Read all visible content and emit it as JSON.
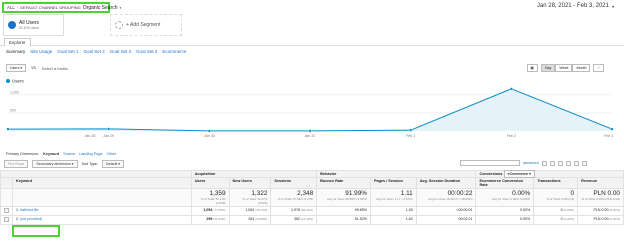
{
  "breadcrumb": {
    "root": "ALL",
    "dimension": "DEFAULT CHANNEL GROUPING",
    "current": "Organic Search"
  },
  "date_range": "Jan 28, 2021 - Feb 3, 2021",
  "segments": {
    "all_users_title": "All Users",
    "all_users_sub": "52.11% Users",
    "add_segment": "+ Add Segment"
  },
  "tabs": {
    "explorer": "Explorer"
  },
  "subtabs": [
    "Summary",
    "Site Usage",
    "Goal Set 1",
    "Goal Set 2",
    "Goal Set 3",
    "Goal Set 4",
    "Ecommerce"
  ],
  "chart_controls": {
    "metric": "Users",
    "vs": "VS.",
    "select_metric": "Select a metric",
    "periods": [
      "Day",
      "Week",
      "Month"
    ]
  },
  "chart_data": {
    "type": "area",
    "series": [
      {
        "name": "Users",
        "values": [
          53,
          59,
          2,
          3,
          23,
          1166,
          53
        ]
      }
    ],
    "categories": [
      "Jan 28",
      "Jan 29",
      "Jan 30",
      "Jan 31",
      "Feb 1",
      "Feb 2",
      "Feb 3"
    ],
    "yticks": [
      "1,000",
      "500"
    ],
    "ylim": [
      0,
      1300
    ],
    "color": "#058dc7"
  },
  "primary_dimension": {
    "label": "Primary Dimension:",
    "options": [
      "Keyword",
      "Source",
      "Landing Page",
      "Other"
    ]
  },
  "table_controls": {
    "plot_rows": "Plot Rows",
    "secondary_dimension": "Secondary dimension",
    "sort_type_label": "Sort Type:",
    "sort_type": "Default",
    "advanced": "advanced"
  },
  "table": {
    "group_headers": {
      "acquisition": "Acquisition",
      "behavior": "Behavior",
      "conversions": "Conversions",
      "ecommerce": "eCommerce"
    },
    "columns": [
      "Keyword",
      "Users",
      "New Users",
      "Sessions",
      "Bounce Rate",
      "Pages / Session",
      "Avg. Session Duration",
      "Ecommerce Conversion Rate",
      "Transactions",
      "Revenue"
    ],
    "totals": {
      "users": "1,359",
      "users_sub": "% of Total: 52.11% (2,608)",
      "new_users": "1,322",
      "new_users_sub": "% of Total: 52.27% (2,529)",
      "sessions": "2,348",
      "sessions_sub": "% of Total: 67.54% (3,476)",
      "bounce": "91.99%",
      "bounce_sub": "Avg for View: 88.85% (3.53%)",
      "pages": "1.11",
      "pages_sub": "Avg for View: 1.17 (-4.97%)",
      "duration": "00:00:22",
      "duration_sub": "Avg for View: 00:00:27 (-18.04%)",
      "ecr": "0.00%",
      "ecr_sub": "Avg for View: 0.00% (0.00%)",
      "transactions": "0",
      "transactions_sub": "% of Total: 0.00% (0)",
      "revenue": "PLN 0.00",
      "revenue_sub": "% of Total: 0.00% (PLN 0.00)"
    },
    "rows": [
      {
        "index": "1.",
        "keyword": "traffcbot.life",
        "users": "1,054",
        "users_pct": "(77.56%)",
        "new_users": "1,054",
        "new_users_pct": "(79.73%)",
        "sessions": "1,978",
        "sessions_pct": "(84.24%)",
        "bounce": "99.65%",
        "pages": "1.00",
        "duration": "<00:00:01",
        "ecr": "0.00%",
        "transactions": "0",
        "transactions_pct": "(0.00%)",
        "revenue": "PLN 0.00",
        "revenue_pct": "(0.00%)"
      },
      {
        "index": "2.",
        "keyword": "(not provided)",
        "users": "299",
        "users_pct": "(21.99%)",
        "new_users": "263",
        "new_users_pct": "(19.89%)",
        "sessions": "362",
        "sessions_pct": "(15.42%)",
        "bounce": "51.52%",
        "pages": "1.62",
        "duration": "00:02:21",
        "ecr": "0.00%",
        "transactions": "0",
        "transactions_pct": "(0.00%)",
        "revenue": "PLN 0.00",
        "revenue_pct": "(0.00%)"
      }
    ]
  }
}
